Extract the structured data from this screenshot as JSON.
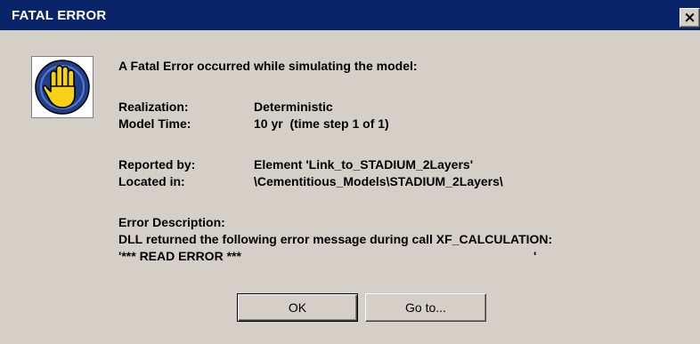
{
  "window": {
    "title": "FATAL ERROR",
    "close_label": "×"
  },
  "icon": "stop-hand-icon",
  "message": {
    "heading": "A Fatal Error occurred while simulating the model:",
    "realization_label": "Realization:",
    "realization_value": "Deterministic",
    "model_time_label": "Model Time:",
    "model_time_value": "10 yr  (time step 1 of 1)",
    "reported_by_label": "Reported by:",
    "reported_by_value": "Element 'Link_to_STADIUM_2Layers'",
    "located_in_label": "Located in:",
    "located_in_value": "\\Cementitious_Models\\STADIUM_2Layers\\",
    "error_description_label": "Error Description:",
    "error_line_1": "DLL returned the following error message during call XF_CALCULATION:",
    "error_line_2": "'*** READ ERROR ***",
    "error_line_2_tail": "'"
  },
  "buttons": {
    "ok_label": "OK",
    "goto_label": "Go to..."
  },
  "colors": {
    "titlebar": "#0a246a",
    "dialog_background": "#d4d0c8",
    "icon_circle": "#1f3f8f",
    "icon_hand": "#f7d117"
  }
}
